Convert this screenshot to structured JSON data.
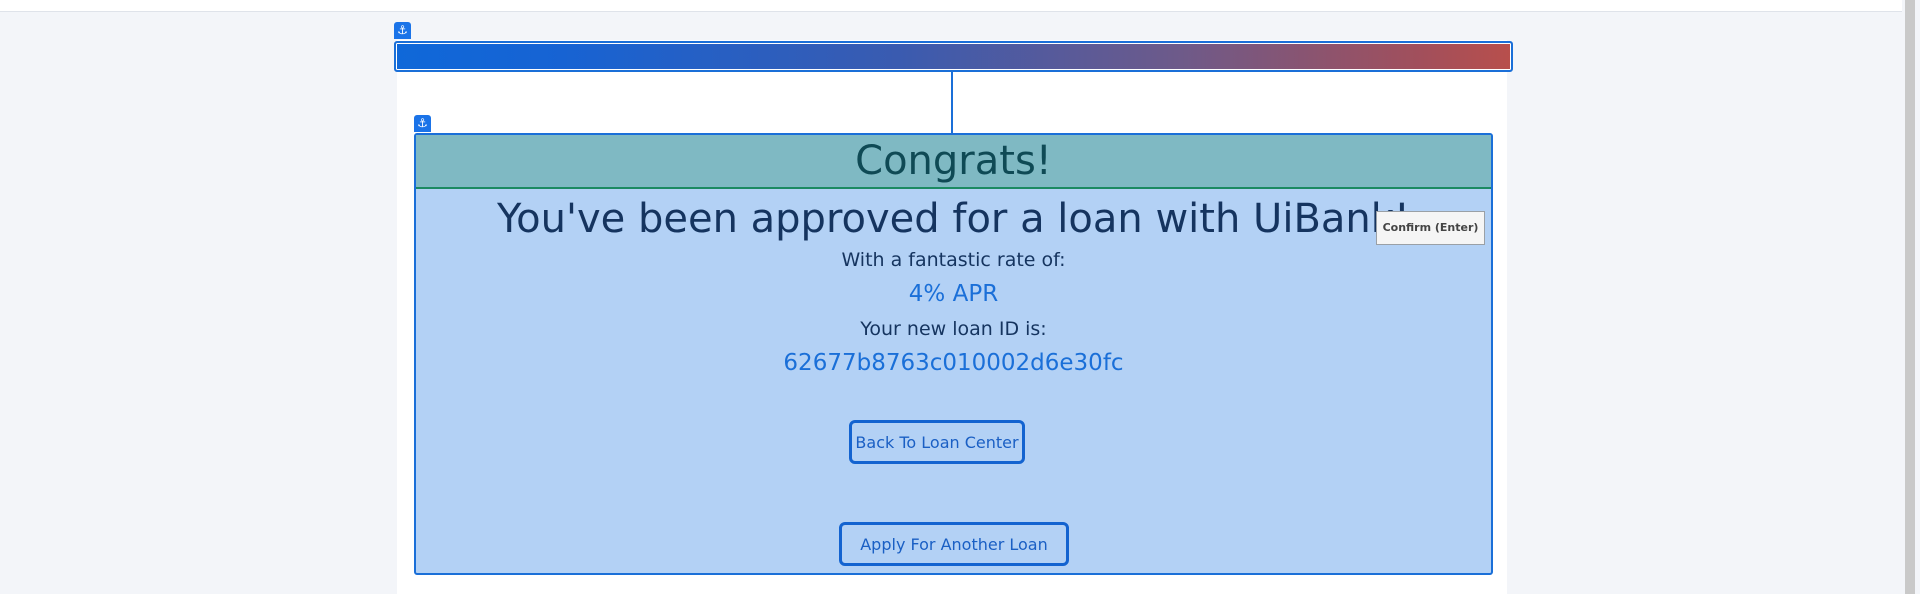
{
  "page": {
    "colors": {
      "accent": "#1a6fd8",
      "card_bg": "#b3d1f5",
      "header_bg": "#7fb9c3",
      "header_border": "#1b8a62",
      "text_dark": "#15345f",
      "gradient_start": "#0f68d9",
      "gradient_end": "#b84f4c"
    }
  },
  "badges": {
    "icon": "anchor-icon",
    "glyph": "⚓"
  },
  "card": {
    "header": {
      "title": "Congrats!"
    },
    "headline": "You've been approved for a loan with UiBank!",
    "rate": {
      "label": "With a fantastic rate of:",
      "value": "4% APR"
    },
    "loan_id": {
      "label": "Your new loan ID is:",
      "value": "62677b8763c010002d6e30fc"
    },
    "buttons": {
      "back_label": "Back To Loan Center",
      "apply_label": "Apply For Another Loan"
    }
  },
  "tooltip": {
    "text": "Confirm (Enter)"
  }
}
